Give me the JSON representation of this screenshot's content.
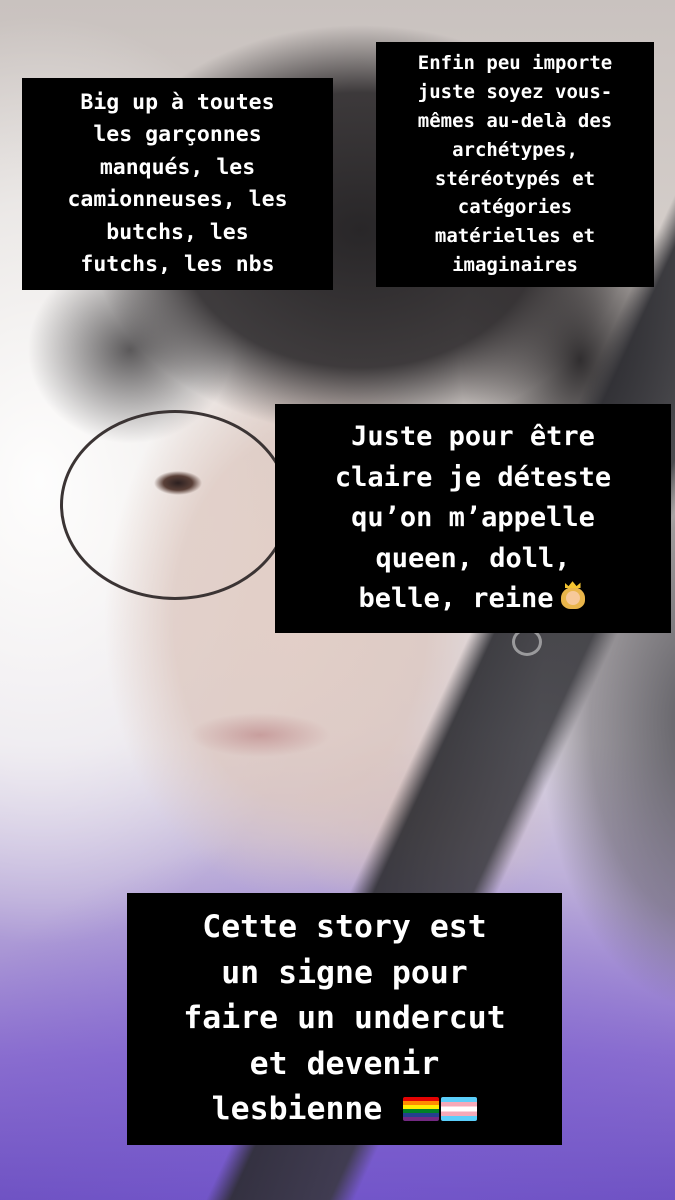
{
  "story": {
    "captions": {
      "bigup": {
        "text": "Big up à toutes\nles garçonnes\nmanqués, les\ncamionneuses, les\nbutchs, les\nfutchs, les nbs"
      },
      "enfin": {
        "text": "Enfin peu importe\njuste soyez vous-\nmêmes au-delà des\narchétypes,\nstéréotypés et\ncatégories\nmatérielles et\nimaginaires"
      },
      "juste": {
        "text": "Juste pour être\nclaire je déteste\nqu’on m’appelle\nqueen, doll,\nbelle, reine",
        "emoji_icon": "princess-emoji-icon"
      },
      "story_sign": {
        "text": "Cette story est\nun signe pour\nfaire un undercut\net devenir\nlesbienne",
        "flags": [
          "rainbow-pride-flag-icon",
          "transgender-flag-icon"
        ]
      }
    },
    "colors": {
      "caption_background": "#000000",
      "caption_text": "#ffffff",
      "shirt_purple": "#7a55cc"
    }
  }
}
